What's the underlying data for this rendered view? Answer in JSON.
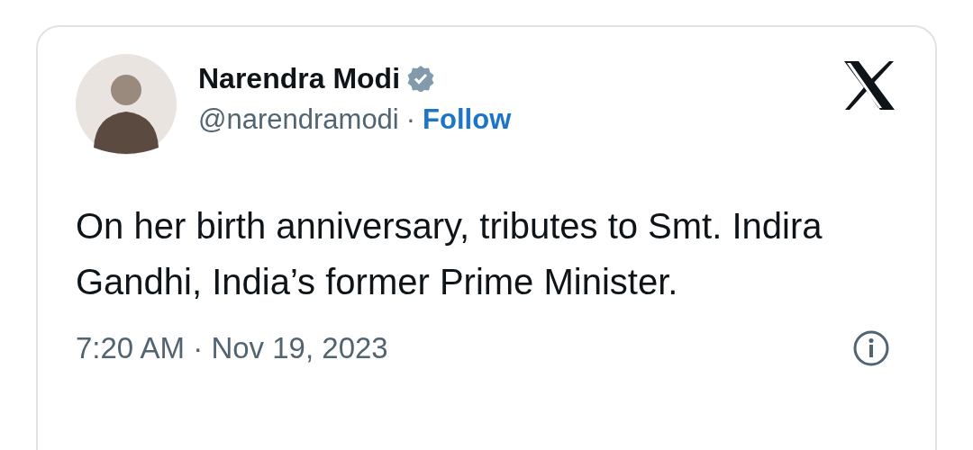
{
  "post": {
    "author": {
      "name": "Narendra Modi",
      "verified": true,
      "handle": "@narendramodi",
      "separator": "·",
      "follow": "Follow"
    },
    "text": "On her birth anniversary, tributes to Smt. Indira Gandhi, India’s former Prime Minister.",
    "timestamp": "7:20 AM · Nov 19, 2023"
  }
}
